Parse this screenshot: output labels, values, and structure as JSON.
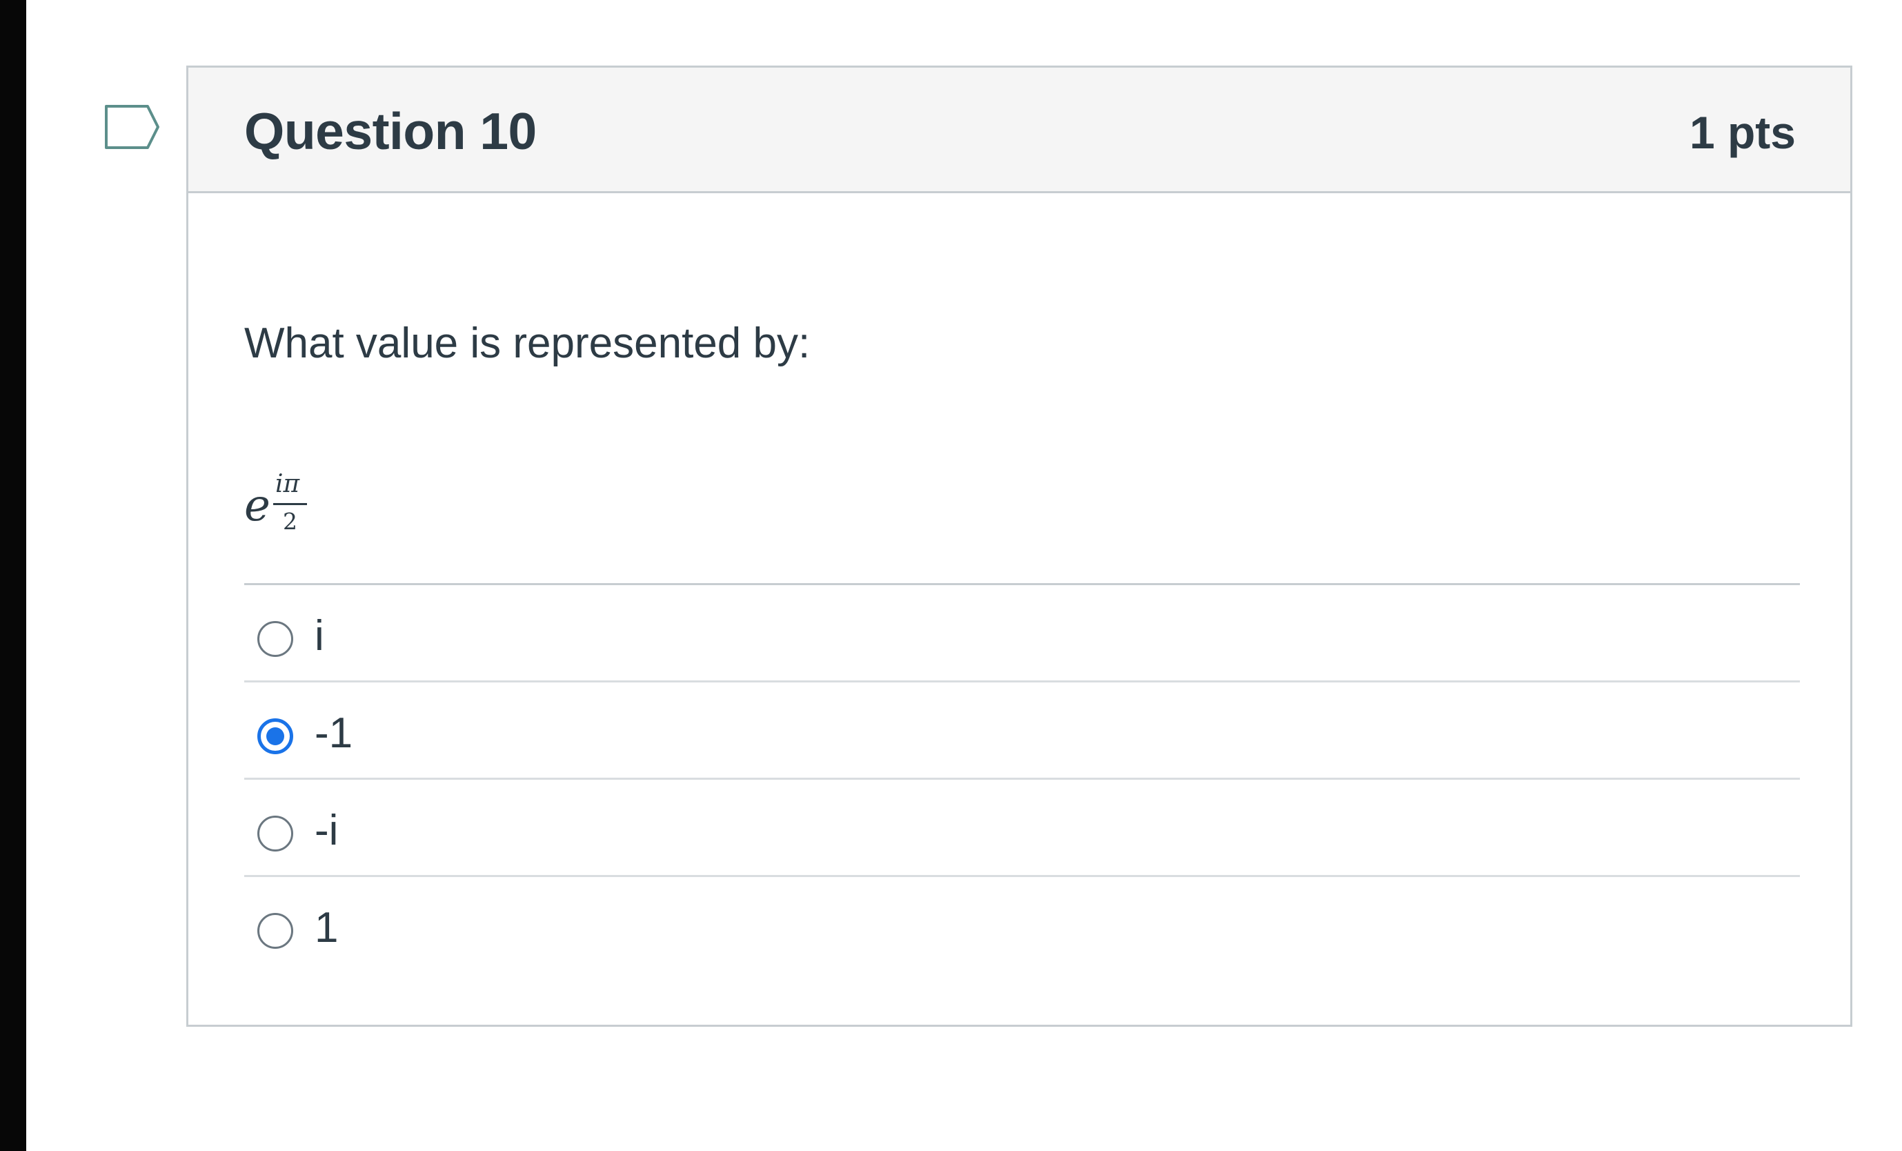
{
  "question": {
    "title": "Question 10",
    "points": "1 pts",
    "text": "What value is represented by:",
    "expression": {
      "base": "e",
      "exponent_numerator": "iπ",
      "exponent_denominator": "2"
    }
  },
  "answers": [
    {
      "label": "i",
      "selected": false
    },
    {
      "label": "-1",
      "selected": true
    },
    {
      "label": "-i",
      "selected": false
    },
    {
      "label": "1",
      "selected": false
    }
  ],
  "colors": {
    "accent": "#1a73e8",
    "text": "#2d3b45",
    "border": "#c7cdd1",
    "header_bg": "#f5f5f5",
    "flag": "#5c8f8b"
  },
  "icons": {
    "flag": "flag-question-icon"
  }
}
